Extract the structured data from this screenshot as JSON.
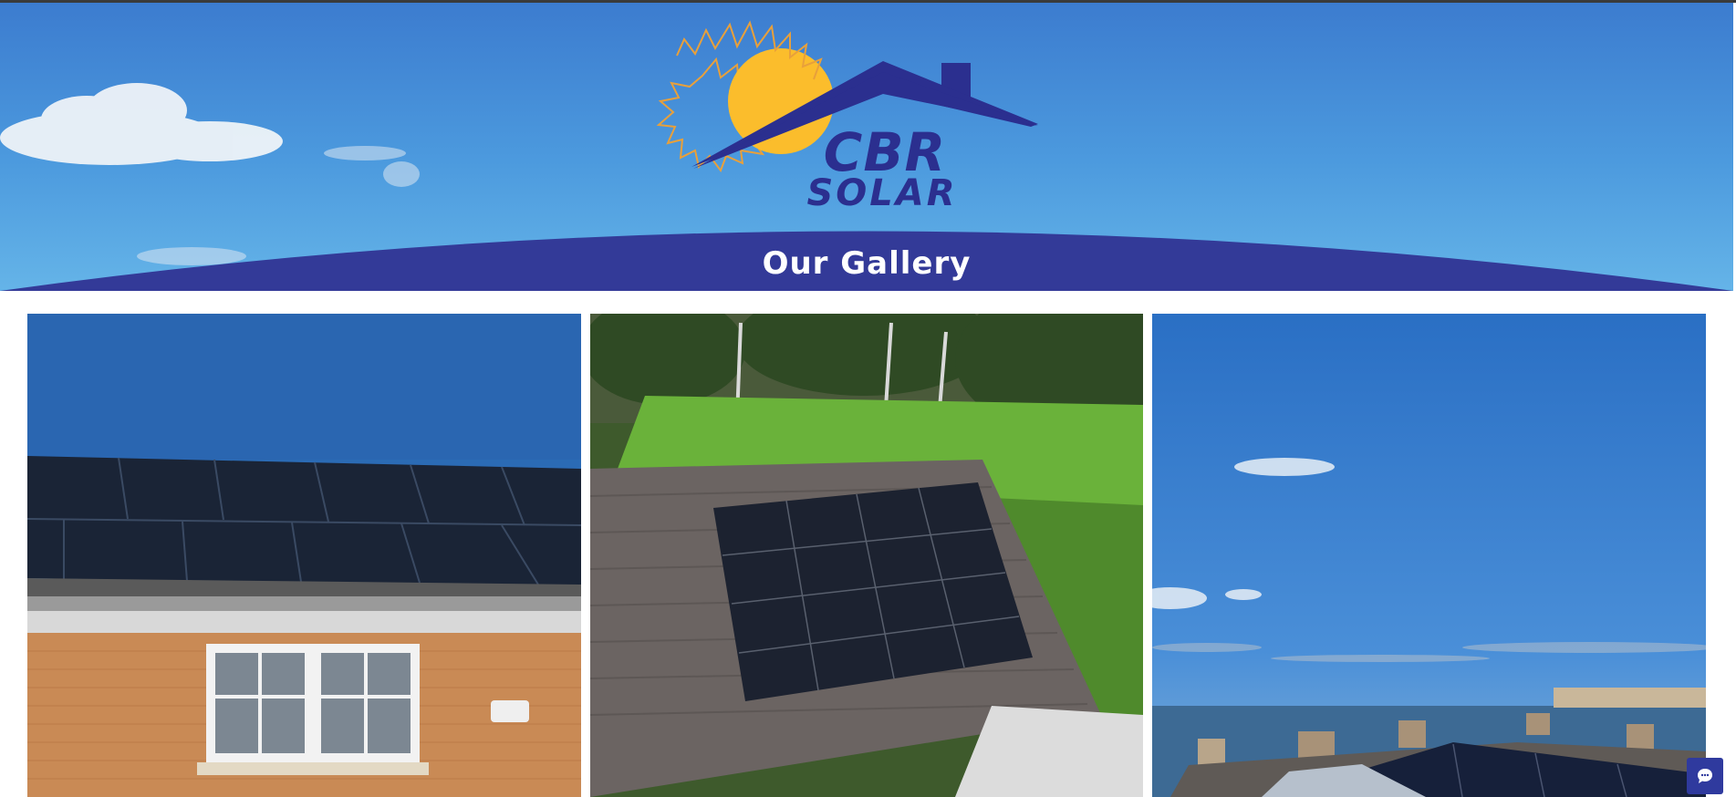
{
  "brand": {
    "name_line1": "CBR",
    "name_line2": "SOLAR",
    "colors": {
      "navy": "#2b2f8f",
      "sun": "#fbbd2c",
      "sky": "#4a92da"
    }
  },
  "header": {
    "page_title": "Our Gallery"
  },
  "gallery": {
    "images": [
      {
        "name": "gallery-image-house-roof-panels",
        "subject": "brick house with black solar panels on roof"
      },
      {
        "name": "gallery-image-tiled-roof-panels",
        "subject": "aerial view of tiled roof with solar panels near woodland"
      },
      {
        "name": "gallery-image-coastal-rooftop-panels",
        "subject": "rooftop solar panels overlooking the sea"
      }
    ]
  },
  "chat": {
    "icon": "chat-bubble-icon"
  }
}
